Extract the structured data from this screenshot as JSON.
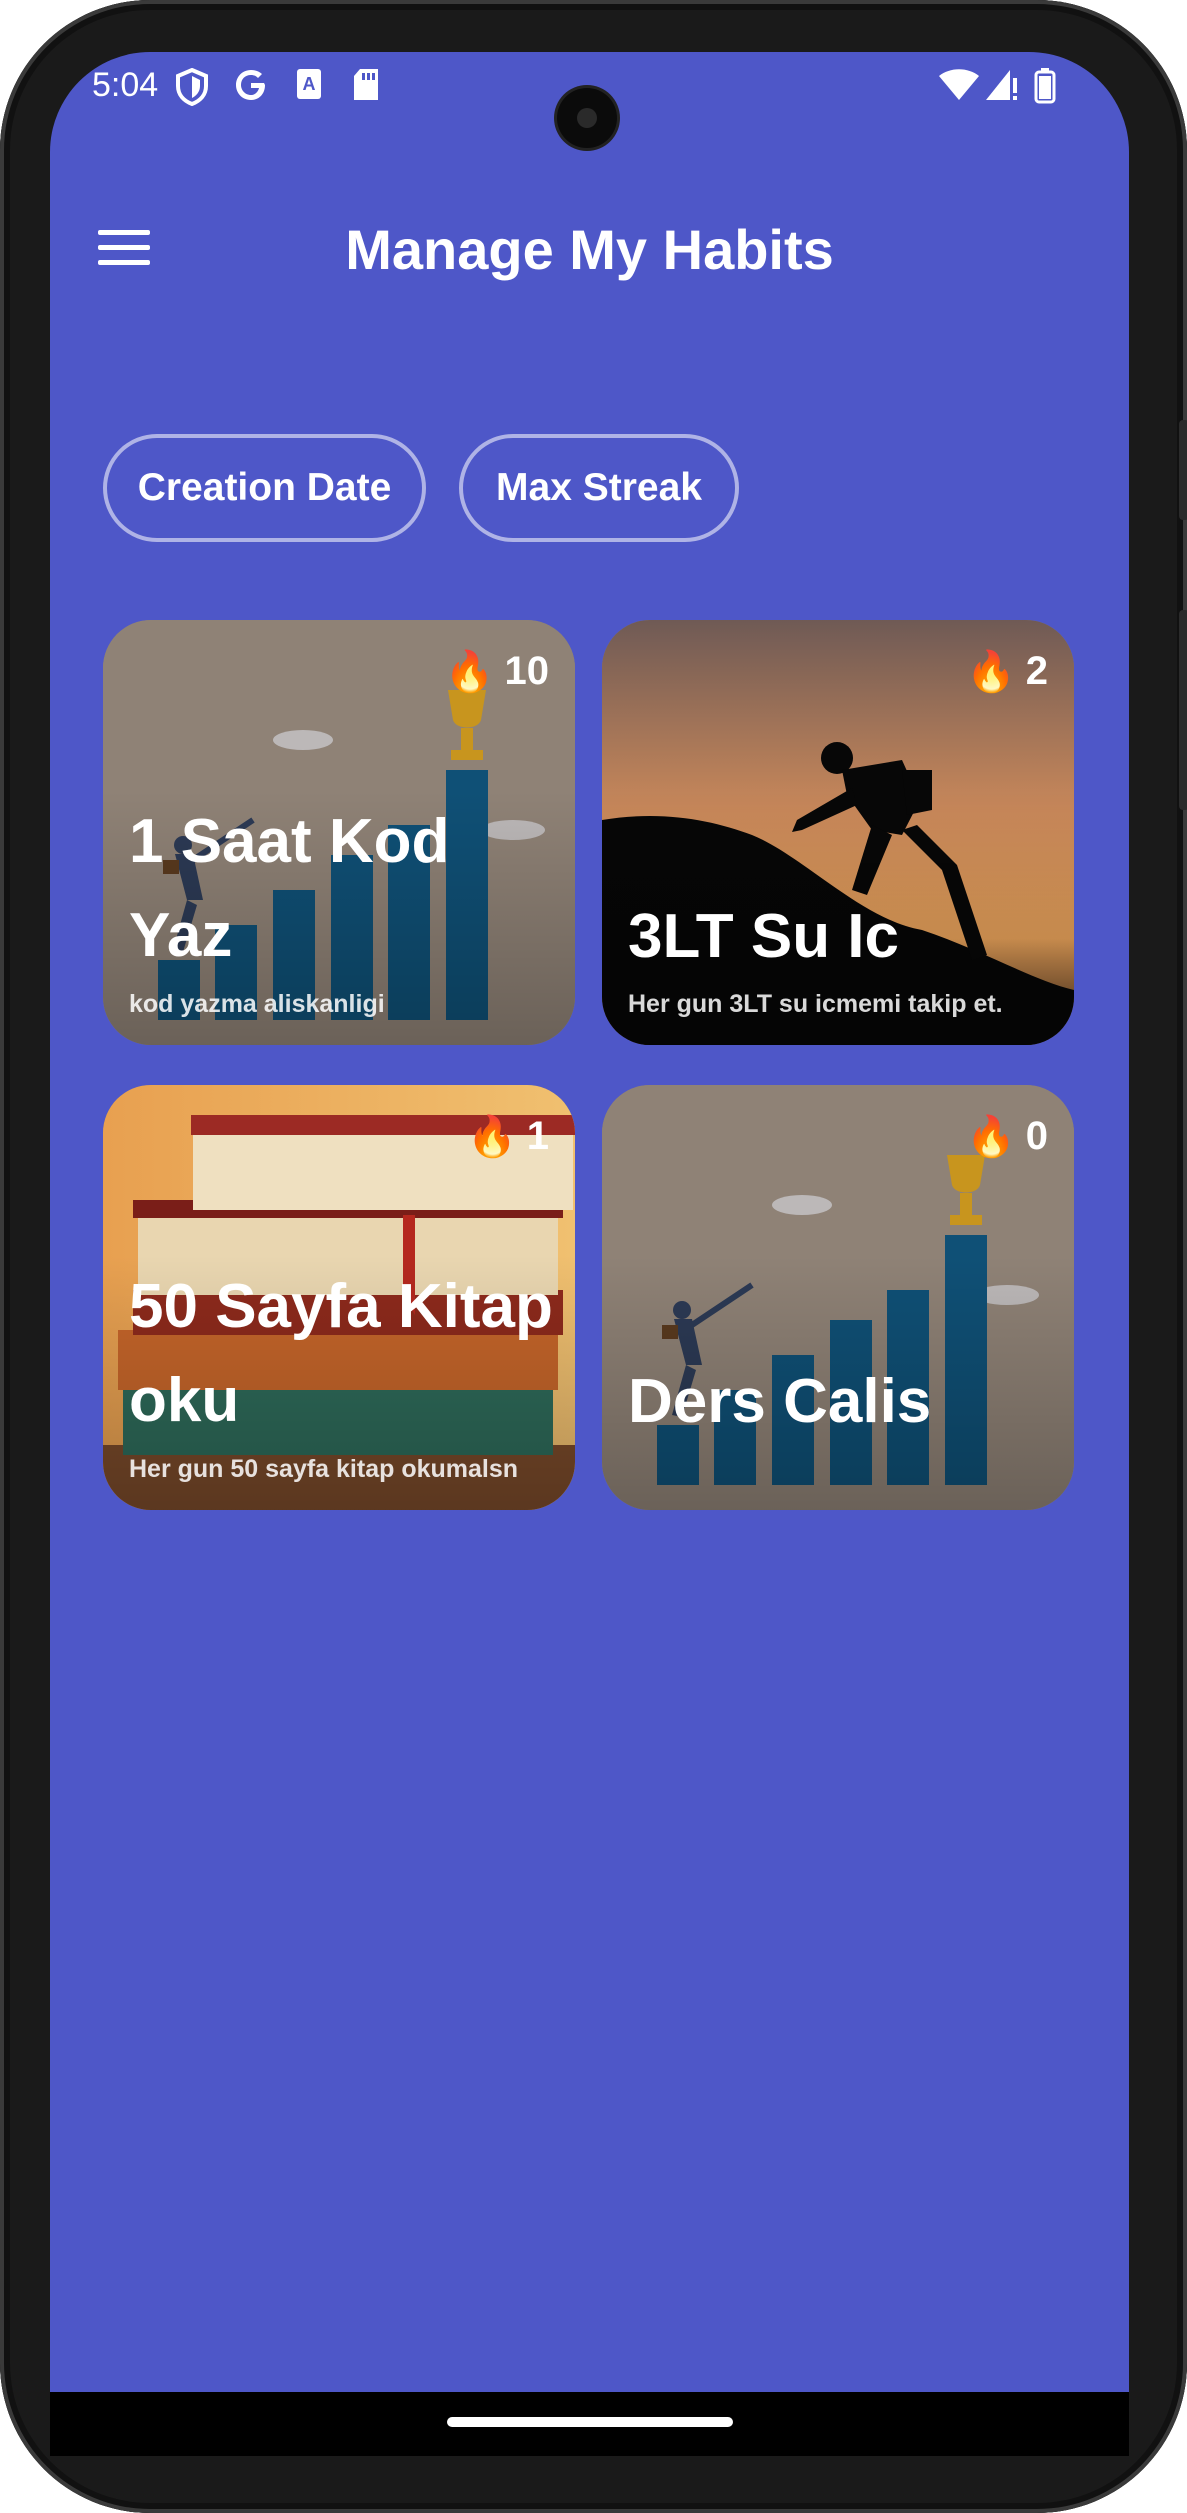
{
  "status_bar": {
    "time": "5:04"
  },
  "app_bar": {
    "title": "Manage My Habits"
  },
  "filters": [
    {
      "label": "Creation Date"
    },
    {
      "label": "Max Streak"
    }
  ],
  "habits": [
    {
      "name": "1 Saat Kod Yaz",
      "description": "kod yazma aliskanligi",
      "streak": "10"
    },
    {
      "name": "3LT Su Ic",
      "description": "Her gun 3LT su icmemi takip et.",
      "streak": "2"
    },
    {
      "name": "50 Sayfa Kitap oku",
      "description": "Her gun 50 sayfa kitap okumalsn",
      "streak": "1"
    },
    {
      "name": "Ders Calis",
      "description": "",
      "streak": "0"
    }
  ],
  "colors": {
    "background": "#4E57C8",
    "card_tint": "#8F8276"
  },
  "icons": [
    "menu-icon",
    "flame-icon",
    "shield-icon",
    "google-icon",
    "wifi-icon",
    "signal-icon",
    "battery-icon"
  ]
}
